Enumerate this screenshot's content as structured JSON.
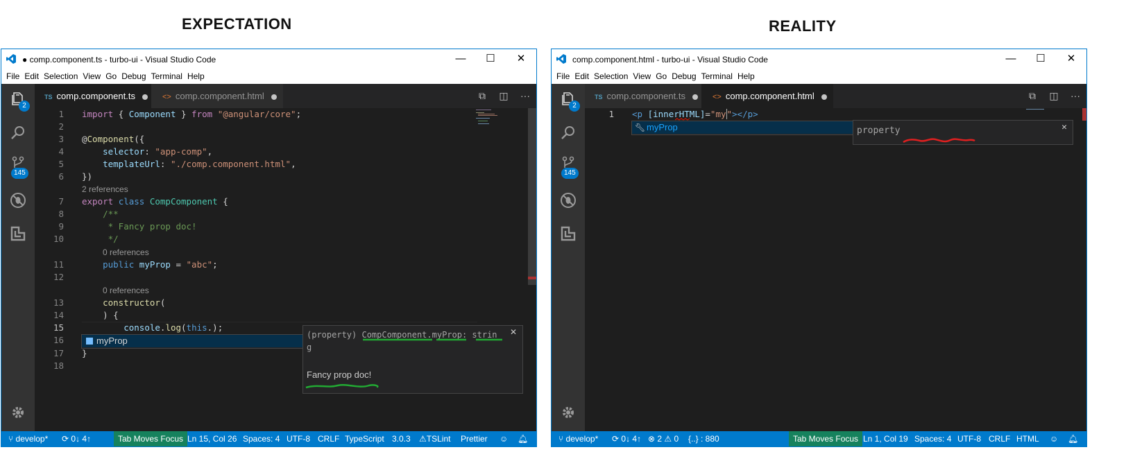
{
  "headings": {
    "left": "EXPECTATION",
    "right": "REALITY"
  },
  "colors": {
    "accent": "#007acc",
    "editor_bg": "#1e1e1e",
    "activity_bg": "#333333",
    "status_highlight": "#16825d",
    "annotation_green": "#22aa33",
    "annotation_red": "#e02020"
  },
  "left": {
    "title": "● comp.component.ts - turbo-ui - Visual Studio Code",
    "menu": [
      "File",
      "Edit",
      "Selection",
      "View",
      "Go",
      "Debug",
      "Terminal",
      "Help"
    ],
    "badges": {
      "explorer": "2",
      "scm": "145"
    },
    "tabs": [
      {
        "icon": "TS",
        "label": "comp.component.ts",
        "active": true
      },
      {
        "icon": "<>",
        "label": "comp.component.html",
        "active": false
      }
    ],
    "line_numbers": [
      "1",
      "2",
      "3",
      "4",
      "5",
      "6",
      "7",
      "8",
      "9",
      "10",
      "11",
      "12",
      "13",
      "14",
      "15",
      "16",
      "17",
      "18"
    ],
    "lenses": {
      "l7": "2 references",
      "l11": "0 references",
      "l13": "0 references"
    },
    "suggest": {
      "label": "myProp"
    },
    "doc": {
      "signature": "(property) CompComponent.myProp: strin",
      "signature_wrap": "g",
      "text": "Fancy prop doc!"
    },
    "status": [
      "develop*",
      "0↓ 4↑",
      "Tab Moves Focus",
      "Ln 15, Col 26",
      "Spaces: 4",
      "UTF-8",
      "CRLF",
      "TypeScript",
      "3.0.3",
      "TSLint",
      "Prettier"
    ]
  },
  "right": {
    "title": "comp.component.html - turbo-ui - Visual Studio Code",
    "menu": [
      "File",
      "Edit",
      "Selection",
      "View",
      "Go",
      "Debug",
      "Terminal",
      "Help"
    ],
    "badges": {
      "explorer": "2",
      "scm": "145"
    },
    "tabs": [
      {
        "icon": "TS",
        "label": "comp.component.ts",
        "active": false
      },
      {
        "icon": "<>",
        "label": "comp.component.html",
        "active": true
      }
    ],
    "line_numbers": [
      "1"
    ],
    "suggest": {
      "label": "myProp"
    },
    "doc": {
      "text": "property"
    },
    "status": [
      "develop*",
      "0↓ 4↑",
      "2",
      "0",
      "{..} : 880",
      "Tab Moves Focus",
      "Ln 1, Col 19",
      "Spaces: 4",
      "UTF-8",
      "CRLF",
      "HTML"
    ]
  }
}
